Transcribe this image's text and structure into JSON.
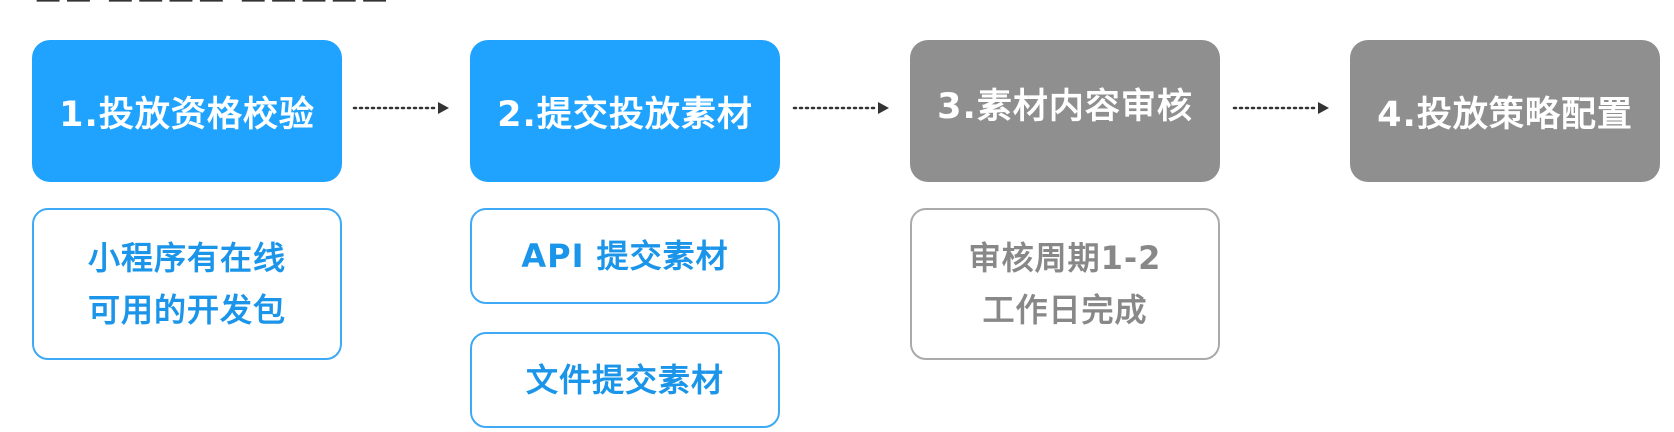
{
  "steps": [
    {
      "label": "1.投放资格校验",
      "color": "#1fa3ff"
    },
    {
      "label": "2.提交投放素材",
      "color": "#1fa3ff"
    },
    {
      "label": "3.素材内容审核",
      "color": "#8f8f8f"
    },
    {
      "label": "4.投放策略配置",
      "color": "#8f8f8f"
    }
  ],
  "notes": {
    "eligibility": {
      "lines": [
        "小程序有在线",
        "可用的开发包"
      ]
    },
    "api_submit": {
      "lines": [
        "API 提交素材"
      ]
    },
    "file_submit": {
      "lines": [
        "文件提交素材"
      ]
    },
    "review_period": {
      "lines": [
        "审核周期1-2",
        "工作日完成"
      ]
    }
  },
  "arrows": [
    {
      "from": "1.投放资格校验",
      "to": "2.提交投放素材",
      "style": "dotted"
    },
    {
      "from": "2.提交投放素材",
      "to": "3.素材内容审核",
      "style": "dotted"
    },
    {
      "from": "3.素材内容审核",
      "to": "4.投放策略配置",
      "style": "dotted"
    }
  ],
  "colors": {
    "active_step": "#1fa3ff",
    "inactive_step": "#8f8f8f",
    "active_note_border": "#3ea9f5",
    "active_note_text": "#1b95ea",
    "inactive_note_border": "#aaaaaa",
    "inactive_note_text": "#888888",
    "arrow": "#333333"
  }
}
